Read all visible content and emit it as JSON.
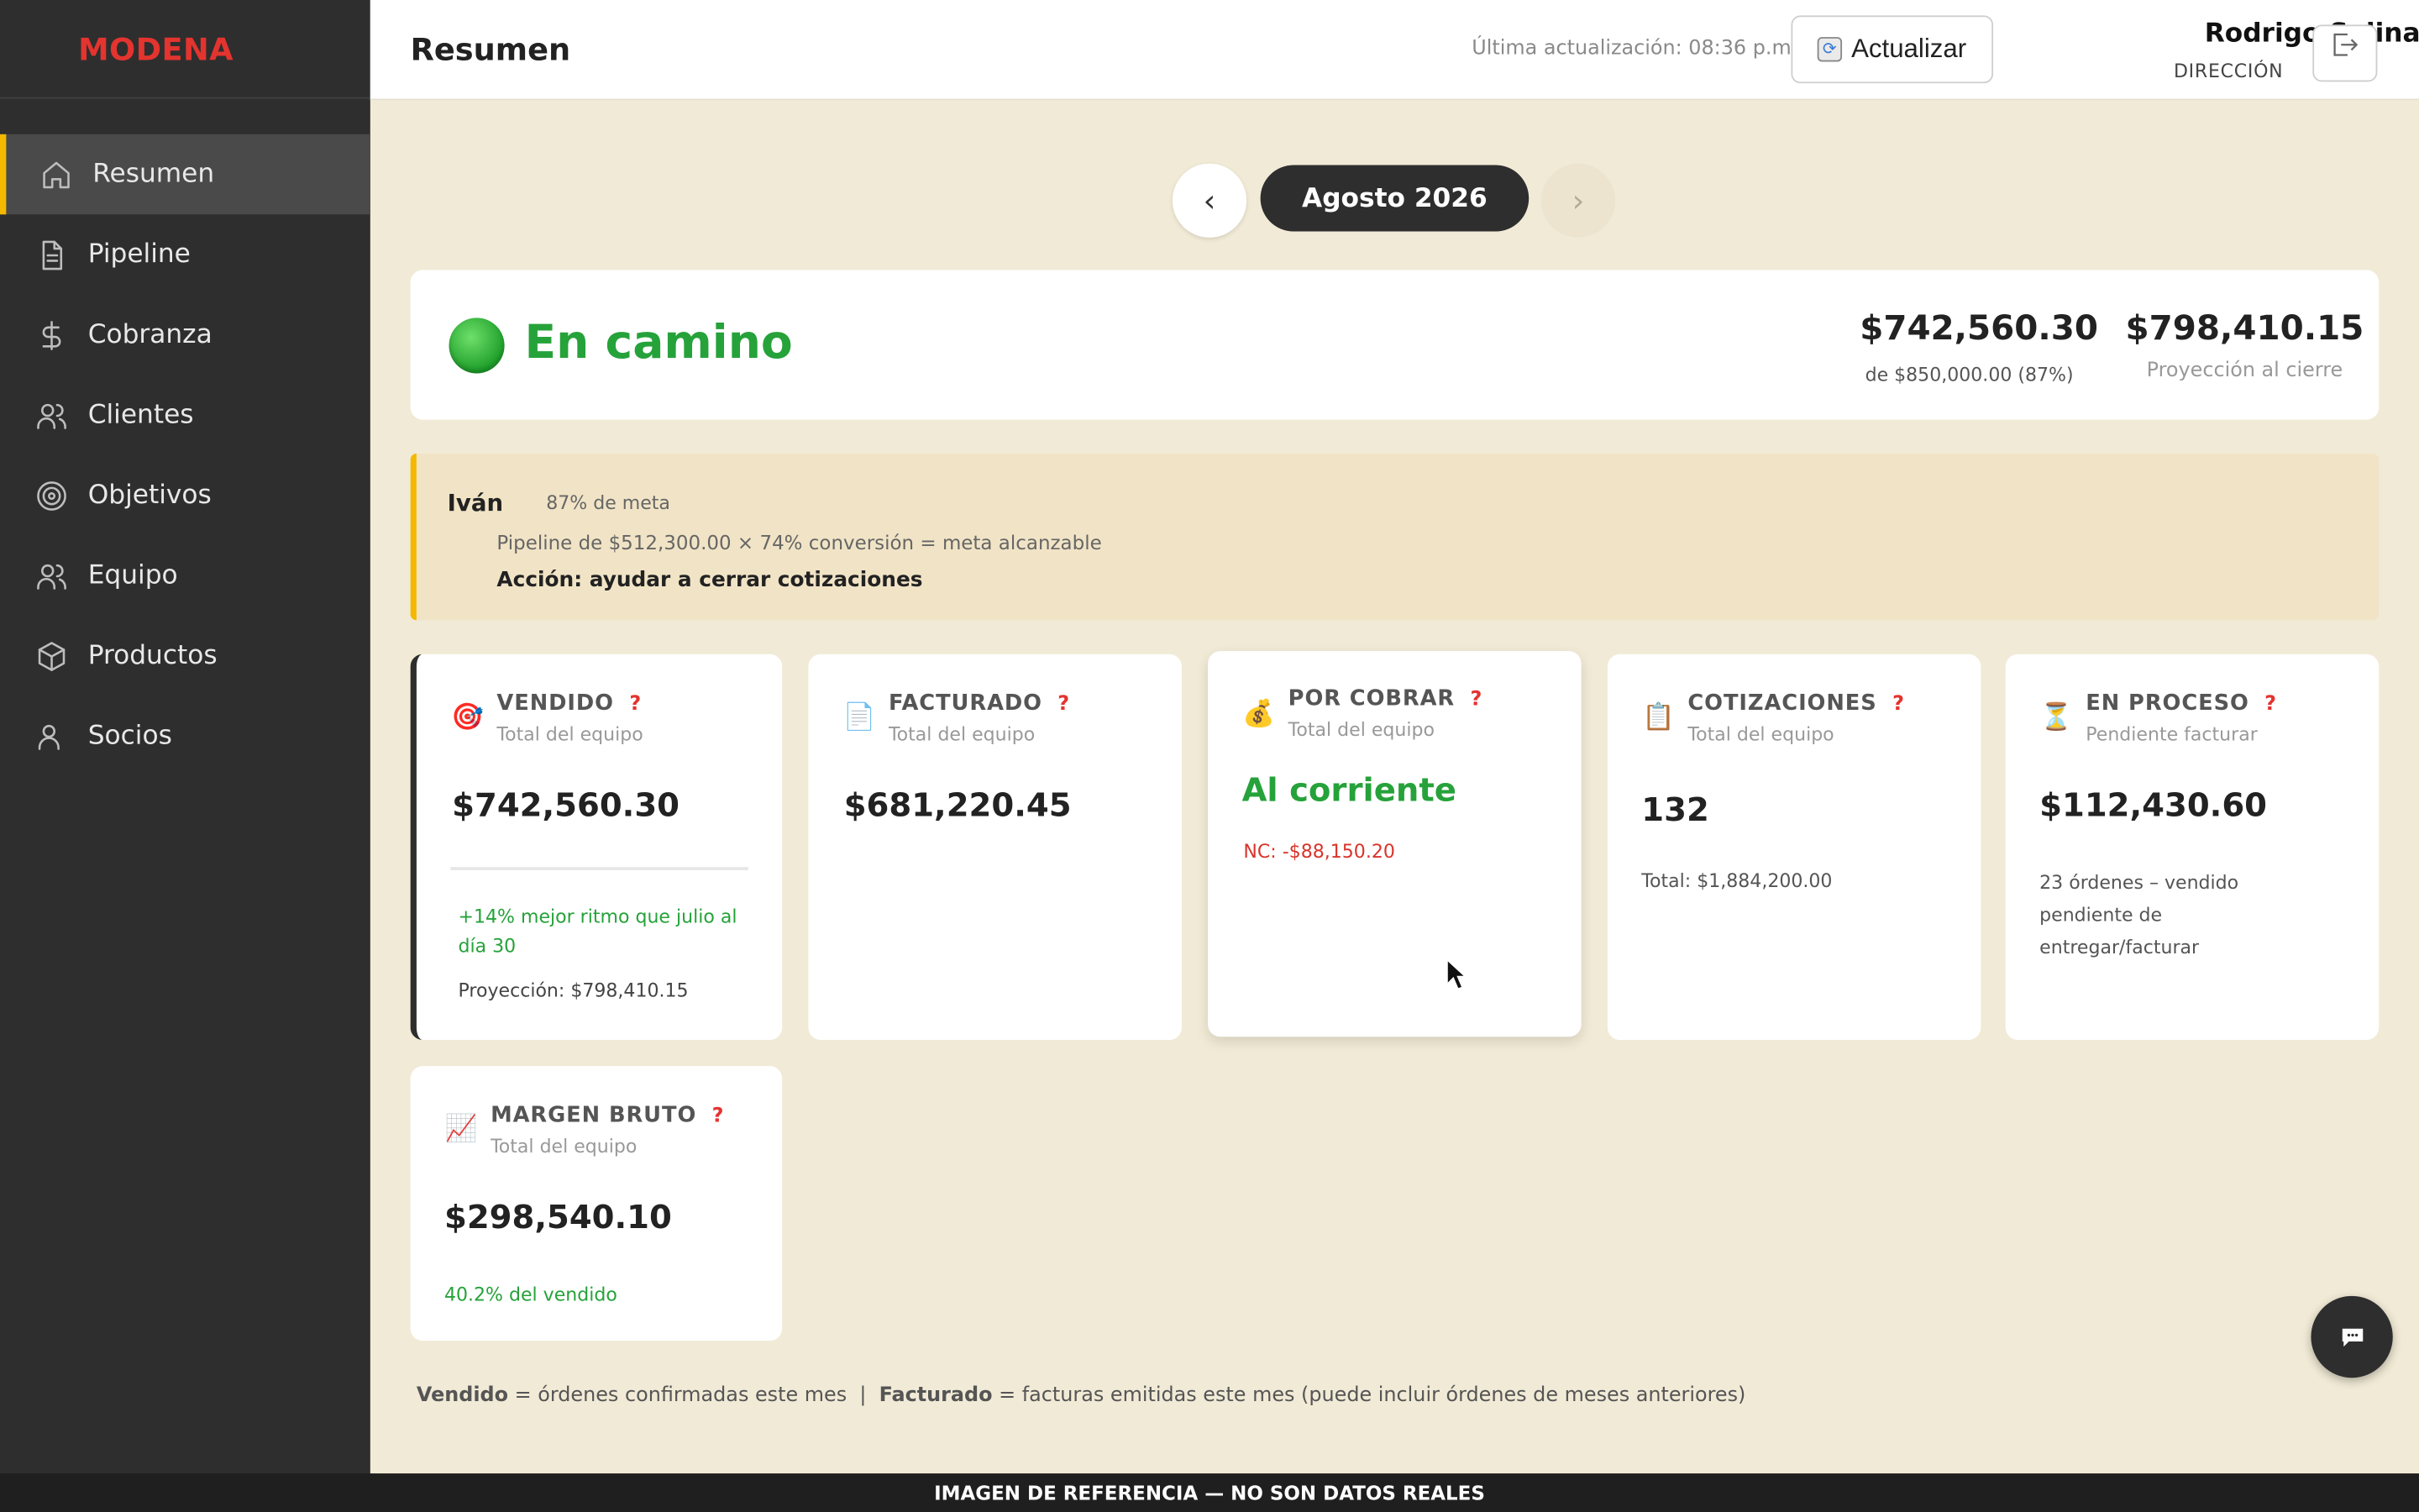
{
  "brand": "MODENA",
  "sidebar": {
    "items": [
      {
        "label": "Resumen",
        "icon": "home-icon",
        "active": true
      },
      {
        "label": "Pipeline",
        "icon": "document-icon"
      },
      {
        "label": "Cobranza",
        "icon": "dollar-icon"
      },
      {
        "label": "Clientes",
        "icon": "users-icon"
      },
      {
        "label": "Objetivos",
        "icon": "target-icon"
      },
      {
        "label": "Equipo",
        "icon": "team-icon"
      },
      {
        "label": "Productos",
        "icon": "box-icon"
      },
      {
        "label": "Socios",
        "icon": "partner-icon"
      }
    ]
  },
  "header": {
    "title": "Resumen",
    "last_update": "Última actualización: 08:36 p.m.",
    "refresh_label": "Actualizar",
    "user_name": "Rodrigo Salinas",
    "user_role": "DIRECCIÓN"
  },
  "month_nav": {
    "current": "Agosto 2026",
    "prev_symbol": "‹",
    "next_symbol": "›"
  },
  "status": {
    "label": "En camino",
    "color": "#26a23a",
    "sold_amount": "$742,560.30",
    "sold_sub": "de $850,000.00 (87%)",
    "projection_amount": "$798,410.15",
    "projection_label": "Proyección al cierre"
  },
  "alert": {
    "name": "Iván",
    "meta": "87% de meta",
    "line": "Pipeline de $512,300.00 × 74% conversión = meta alcanzable",
    "action": "Acción: ayudar a cerrar cotizaciones"
  },
  "cards": {
    "vendido": {
      "icon": "target-dart-icon",
      "title": "VENDIDO",
      "q": "?",
      "sub": "Total del equipo",
      "value": "$742,560.30",
      "note1": "+14% mejor ritmo que julio al día 30",
      "note2": "Proyección: $798,410.15"
    },
    "facturado": {
      "icon": "invoice-icon",
      "title": "FACTURADO",
      "q": "?",
      "sub": "Total del equipo",
      "value": "$681,220.45"
    },
    "por_cobrar": {
      "icon": "money-bag-icon",
      "title": "POR COBRAR",
      "q": "?",
      "sub": "Total del equipo",
      "value": "Al corriente",
      "note": "NC: -$88,150.20"
    },
    "cotizaciones": {
      "icon": "clipboard-icon",
      "title": "COTIZACIONES",
      "q": "?",
      "sub": "Total del equipo",
      "value": "132",
      "note": "Total: $1,884,200.00"
    },
    "en_proceso": {
      "icon": "hourglass-icon",
      "title": "EN PROCESO",
      "q": "?",
      "sub": "Pendiente facturar",
      "value": "$112,430.60",
      "note": "23 órdenes – vendido pendiente de entregar/facturar"
    },
    "margen": {
      "icon": "chart-up-icon",
      "title": "MARGEN BRUTO",
      "q": "?",
      "sub": "Total del equipo",
      "value": "$298,540.10",
      "note": "40.2% del vendido"
    }
  },
  "footnote": {
    "term1": "Vendido",
    "def1": " = órdenes confirmadas este mes  |  ",
    "term2": "Facturado",
    "def2": " = facturas emitidas este mes (puede incluir órdenes de meses anteriores)"
  },
  "banner": "IMAGEN DE REFERENCIA — NO SON DATOS REALES",
  "colors": {
    "sidebar_bg": "#2e2e2e",
    "accent": "#f5b800",
    "brand_red": "#e3342f",
    "success": "#26a23a",
    "page_bg": "#f1ead6"
  }
}
